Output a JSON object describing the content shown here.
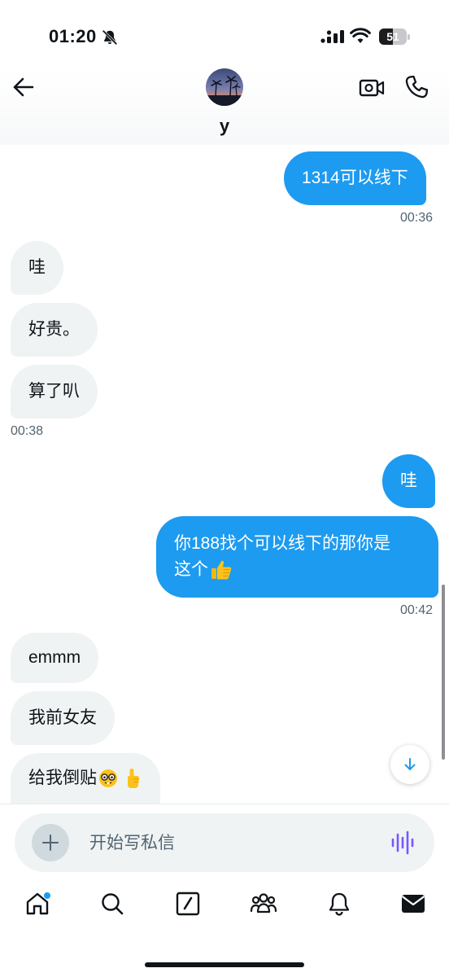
{
  "status_bar": {
    "time": "01:20",
    "battery_level": "51",
    "icons": [
      "bell-slash-icon",
      "signal-icon",
      "wifi-icon",
      "battery-icon"
    ]
  },
  "header": {
    "contact_name": "y",
    "icons": [
      "back-arrow-icon",
      "video-call-icon",
      "phone-icon"
    ]
  },
  "messages": [
    {
      "direction": "out",
      "text": "1314可以线下"
    },
    {
      "direction": "out",
      "timestamp": "00:36"
    },
    {
      "direction": "in",
      "text": "哇"
    },
    {
      "direction": "in",
      "text": "好贵。"
    },
    {
      "direction": "in",
      "text": "算了叭"
    },
    {
      "direction": "in",
      "timestamp": "00:38"
    },
    {
      "direction": "out",
      "text": "哇"
    },
    {
      "direction": "out",
      "text_line1": "你188找个可以线下的那你是",
      "text_line2": "这个",
      "emoji": "thumbs-up"
    },
    {
      "direction": "out",
      "timestamp": "00:42"
    },
    {
      "direction": "in",
      "text": "emmm"
    },
    {
      "direction": "in",
      "text": "我前女友"
    },
    {
      "direction": "in",
      "text": "给我倒贴",
      "emoji": [
        "nerd-face",
        "index-pointing-up"
      ]
    }
  ],
  "composer": {
    "placeholder": "开始写私信",
    "icons": [
      "plus-icon",
      "voice-message-icon"
    ]
  },
  "bottom_nav": {
    "items": [
      "home",
      "search",
      "compose",
      "communities",
      "notifications",
      "messages"
    ],
    "active": "messages",
    "home_has_notification_dot": true
  },
  "colors": {
    "accent": "#1d9bf0",
    "incoming_bubble": "#eff3f4",
    "text_primary": "#0f1419",
    "text_secondary": "#536471",
    "voice_icon": "#7856ff"
  }
}
